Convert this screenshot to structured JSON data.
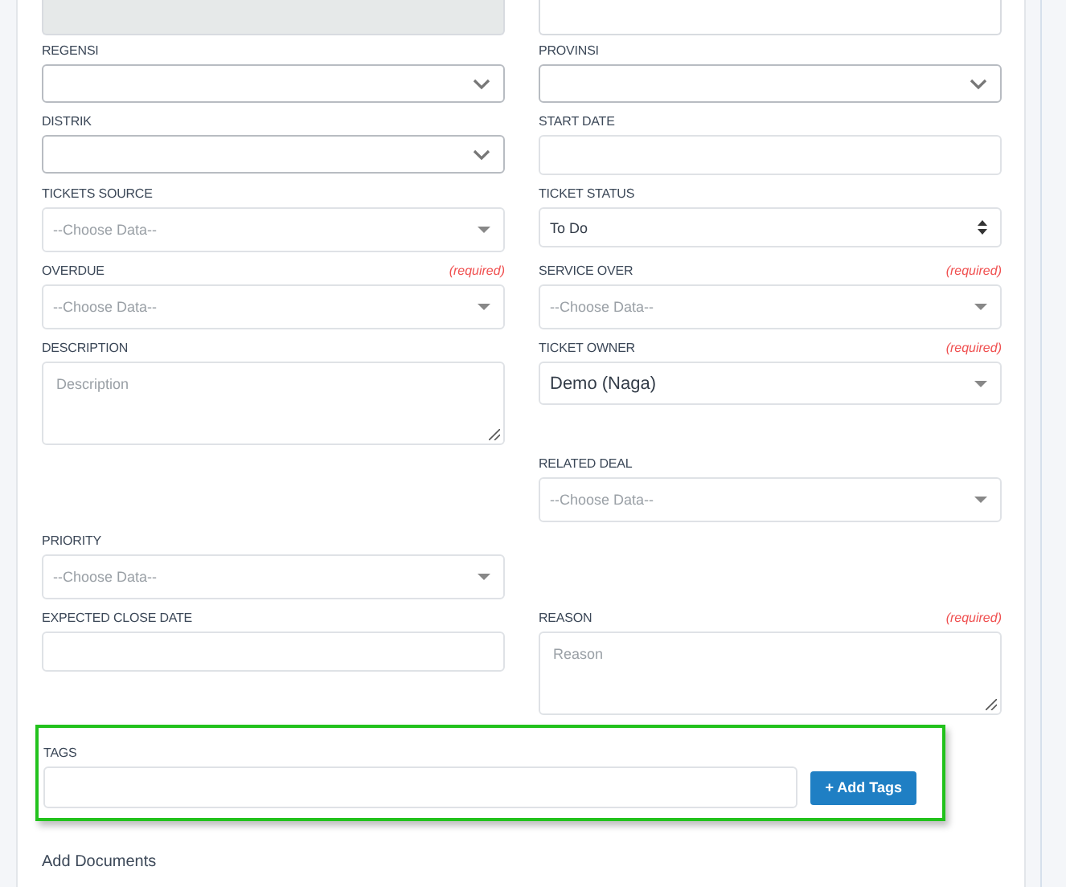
{
  "cut_fields": [
    {
      "disabled": true
    },
    {
      "disabled": false
    }
  ],
  "rows": [
    {
      "left": {
        "label": "REGENSI",
        "kind": "chevron-select"
      },
      "right": {
        "label": "PROVINSI",
        "kind": "chevron-select"
      }
    },
    {
      "left": {
        "label": "DISTRIK",
        "kind": "chevron-select"
      },
      "right": {
        "label": "START DATE",
        "kind": "text"
      }
    },
    {
      "left": {
        "label": "TICKETS SOURCE",
        "kind": "dropdown",
        "placeholder": "--Choose Data--"
      },
      "right": {
        "label": "TICKET STATUS",
        "kind": "stepper-select",
        "value": "To Do"
      }
    },
    {
      "left": {
        "label": "OVERDUE",
        "kind": "dropdown",
        "placeholder": "--Choose Data--",
        "required_note": "(required)"
      },
      "right": {
        "label": "SERVICE OVER",
        "kind": "dropdown",
        "placeholder": "--Choose Data--",
        "required_note": "(required)"
      }
    },
    {
      "left": {
        "label": "DESCRIPTION",
        "kind": "textarea",
        "placeholder": "Description"
      },
      "right": {
        "label": "TICKET OWNER",
        "kind": "dropdown",
        "value": "Demo (Naga)",
        "required_note": "(required)"
      }
    },
    {
      "right": {
        "label": "RELATED DEAL",
        "kind": "dropdown",
        "placeholder": "--Choose Data--"
      }
    },
    {
      "left": {
        "label": "PRIORITY",
        "kind": "dropdown",
        "placeholder": "--Choose Data--"
      }
    },
    {
      "left": {
        "label": "EXPECTED CLOSE DATE",
        "kind": "text"
      },
      "right": {
        "label": "REASON",
        "kind": "textarea",
        "placeholder": "Reason",
        "required_note": "(required)"
      }
    }
  ],
  "tags": {
    "label": "TAGS",
    "button": "+ Add Tags",
    "highlighted": true
  },
  "documents_link": "Add Documents"
}
